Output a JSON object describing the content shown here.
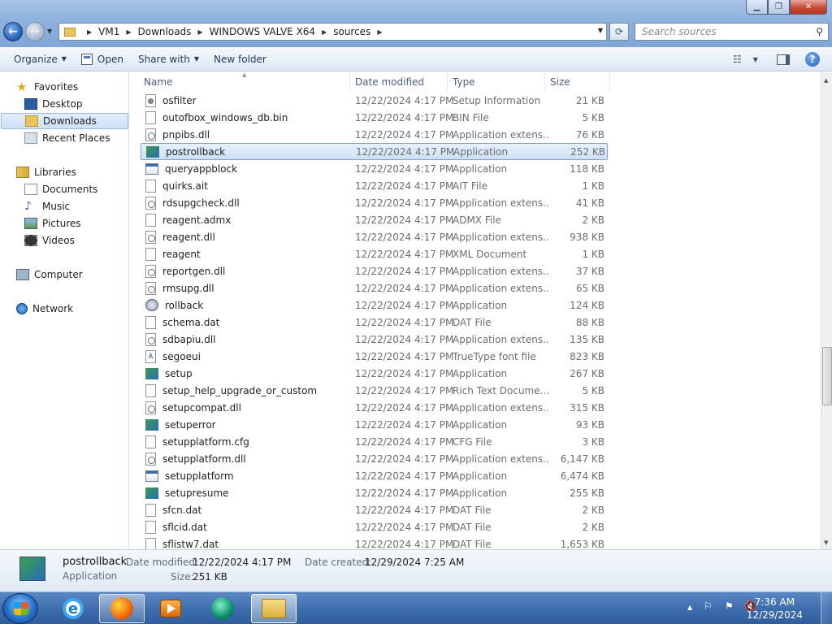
{
  "window": {
    "search_placeholder": "Search sources",
    "breadcrumbs": [
      "VM1",
      "Downloads",
      "WINDOWS VALVE X64",
      "sources"
    ]
  },
  "toolbar": {
    "organize": "Organize",
    "open": "Open",
    "share_with": "Share with",
    "new_folder": "New folder",
    "help": "?"
  },
  "nav": {
    "favorites": "Favorites",
    "desktop": "Desktop",
    "downloads": "Downloads",
    "recent_places": "Recent Places",
    "libraries": "Libraries",
    "documents": "Documents",
    "music": "Music",
    "pictures": "Pictures",
    "videos": "Videos",
    "computer": "Computer",
    "network": "Network"
  },
  "columns": {
    "name": "Name",
    "date": "Date modified",
    "type": "Type",
    "size": "Size"
  },
  "files": [
    {
      "name": "osfilter",
      "date": "12/22/2024 4:17 PM",
      "type": "Setup Information",
      "size": "21 KB",
      "icon": "inf"
    },
    {
      "name": "outofbox_windows_db.bin",
      "date": "12/22/2024 4:17 PM",
      "type": "BIN File",
      "size": "5 KB",
      "icon": "file"
    },
    {
      "name": "pnpibs.dll",
      "date": "12/22/2024 4:17 PM",
      "type": "Application extens...",
      "size": "76 KB",
      "icon": "dll"
    },
    {
      "name": "postrollback",
      "date": "12/22/2024 4:17 PM",
      "type": "Application",
      "size": "252 KB",
      "icon": "setup",
      "selected": true
    },
    {
      "name": "queryappblock",
      "date": "12/22/2024 4:17 PM",
      "type": "Application",
      "size": "118 KB",
      "icon": "app"
    },
    {
      "name": "quirks.ait",
      "date": "12/22/2024 4:17 PM",
      "type": "AIT File",
      "size": "1 KB",
      "icon": "file"
    },
    {
      "name": "rdsupgcheck.dll",
      "date": "12/22/2024 4:17 PM",
      "type": "Application extens...",
      "size": "41 KB",
      "icon": "dll"
    },
    {
      "name": "reagent.admx",
      "date": "12/22/2024 4:17 PM",
      "type": "ADMX File",
      "size": "2 KB",
      "icon": "file"
    },
    {
      "name": "reagent.dll",
      "date": "12/22/2024 4:17 PM",
      "type": "Application extens...",
      "size": "938 KB",
      "icon": "dll"
    },
    {
      "name": "reagent",
      "date": "12/22/2024 4:17 PM",
      "type": "XML Document",
      "size": "1 KB",
      "icon": "file"
    },
    {
      "name": "reportgen.dll",
      "date": "12/22/2024 4:17 PM",
      "type": "Application extens...",
      "size": "37 KB",
      "icon": "dll"
    },
    {
      "name": "rmsupg.dll",
      "date": "12/22/2024 4:17 PM",
      "type": "Application extens...",
      "size": "65 KB",
      "icon": "dll"
    },
    {
      "name": "rollback",
      "date": "12/22/2024 4:17 PM",
      "type": "Application",
      "size": "124 KB",
      "icon": "rb"
    },
    {
      "name": "schema.dat",
      "date": "12/22/2024 4:17 PM",
      "type": "DAT File",
      "size": "88 KB",
      "icon": "file"
    },
    {
      "name": "sdbapiu.dll",
      "date": "12/22/2024 4:17 PM",
      "type": "Application extens...",
      "size": "135 KB",
      "icon": "dll"
    },
    {
      "name": "segoeui",
      "date": "12/22/2024 4:17 PM",
      "type": "TrueType font file",
      "size": "823 KB",
      "icon": "font"
    },
    {
      "name": "setup",
      "date": "12/22/2024 4:17 PM",
      "type": "Application",
      "size": "267 KB",
      "icon": "setup"
    },
    {
      "name": "setup_help_upgrade_or_custom",
      "date": "12/22/2024 4:17 PM",
      "type": "Rich Text Docume...",
      "size": "5 KB",
      "icon": "file"
    },
    {
      "name": "setupcompat.dll",
      "date": "12/22/2024 4:17 PM",
      "type": "Application extens...",
      "size": "315 KB",
      "icon": "dll"
    },
    {
      "name": "setuperror",
      "date": "12/22/2024 4:17 PM",
      "type": "Application",
      "size": "93 KB",
      "icon": "setup"
    },
    {
      "name": "setupplatform.cfg",
      "date": "12/22/2024 4:17 PM",
      "type": "CFG File",
      "size": "3 KB",
      "icon": "file"
    },
    {
      "name": "setupplatform.dll",
      "date": "12/22/2024 4:17 PM",
      "type": "Application extens...",
      "size": "6,147 KB",
      "icon": "dll"
    },
    {
      "name": "setupplatform",
      "date": "12/22/2024 4:17 PM",
      "type": "Application",
      "size": "6,474 KB",
      "icon": "app"
    },
    {
      "name": "setupresume",
      "date": "12/22/2024 4:17 PM",
      "type": "Application",
      "size": "255 KB",
      "icon": "setup"
    },
    {
      "name": "sfcn.dat",
      "date": "12/22/2024 4:17 PM",
      "type": "DAT File",
      "size": "2 KB",
      "icon": "file"
    },
    {
      "name": "sflcid.dat",
      "date": "12/22/2024 4:17 PM",
      "type": "DAT File",
      "size": "2 KB",
      "icon": "file"
    },
    {
      "name": "sflistw7.dat",
      "date": "12/22/2024 4:17 PM",
      "type": "DAT File",
      "size": "1,653 KB",
      "icon": "file"
    }
  ],
  "details": {
    "name": "postrollback",
    "type": "Application",
    "modified_label": "Date modified:",
    "modified_value": "12/22/2024 4:17 PM",
    "created_label": "Date created:",
    "created_value": "12/29/2024 7:25 AM",
    "size_label": "Size:",
    "size_value": "251 KB"
  },
  "taskbar": {
    "time": "7:36 AM",
    "date": "12/29/2024"
  }
}
